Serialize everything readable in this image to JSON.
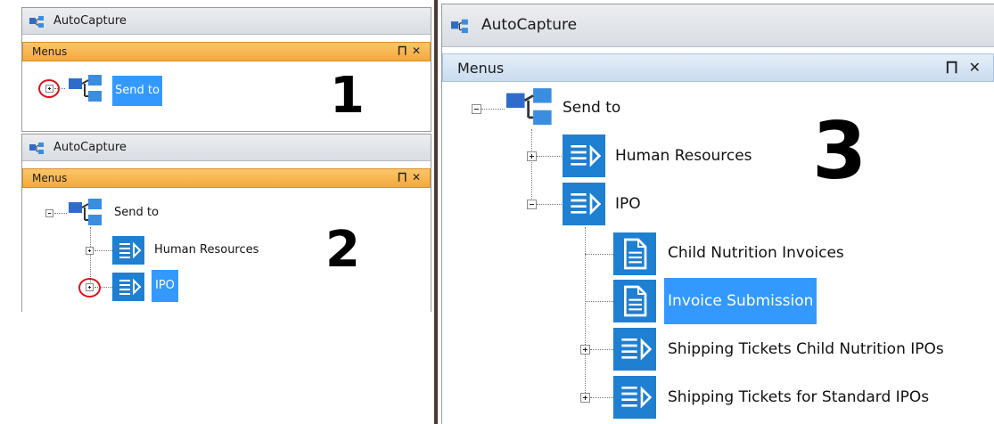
{
  "app_title": "AutoCapture",
  "pane_title": "Menus",
  "pane_pin_glyph": "⨅",
  "pane_close_glyph": "✕",
  "step_numbers": [
    "1",
    "2",
    "3"
  ],
  "colors": {
    "accent_orange": "#f8b24a",
    "accent_blue_header": "#d6e6f5",
    "selection": "#3399ff",
    "tile_blue": "#1f7fd1",
    "ring_red": "#e0101a"
  },
  "panel1": {
    "root_label": "Send to"
  },
  "panel2": {
    "root_label": "Send to",
    "items": [
      "Human Resources",
      "IPO"
    ]
  },
  "panel3": {
    "root_label": "Send to",
    "items": [
      "Human Resources",
      "IPO"
    ],
    "ipo_children": [
      "Child Nutrition Invoices",
      "Invoice Submission",
      "Shipping Tickets Child Nutrition IPOs",
      "Shipping Tickets for Standard IPOs"
    ]
  }
}
